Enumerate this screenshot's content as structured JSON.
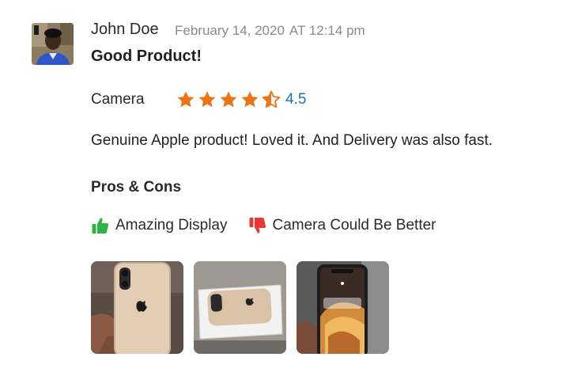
{
  "review": {
    "author": "John Doe",
    "date": "February 14, 2020",
    "time": "AT 12:14 pm",
    "title": "Good Product!",
    "rating": {
      "label": "Camera",
      "value": "4.5",
      "stars": 4.5,
      "max": 5,
      "star_color": "#ec7418",
      "value_color": "#1a73b8"
    },
    "text": "Genuine Apple product! Loved it. And Delivery was also fast.",
    "pros_cons": {
      "heading": "Pros & Cons",
      "pro": {
        "label": "Amazing Display",
        "icon": "thumbs-up-icon",
        "color": "#2fb344"
      },
      "con": {
        "label": "Camera Could Be Better",
        "icon": "thumbs-down-icon",
        "color": "#e53935"
      }
    },
    "photos": [
      {
        "name": "photo-iphone-back-in-hand"
      },
      {
        "name": "photo-iphone-in-box"
      },
      {
        "name": "photo-iphone-lock-screen"
      }
    ]
  }
}
